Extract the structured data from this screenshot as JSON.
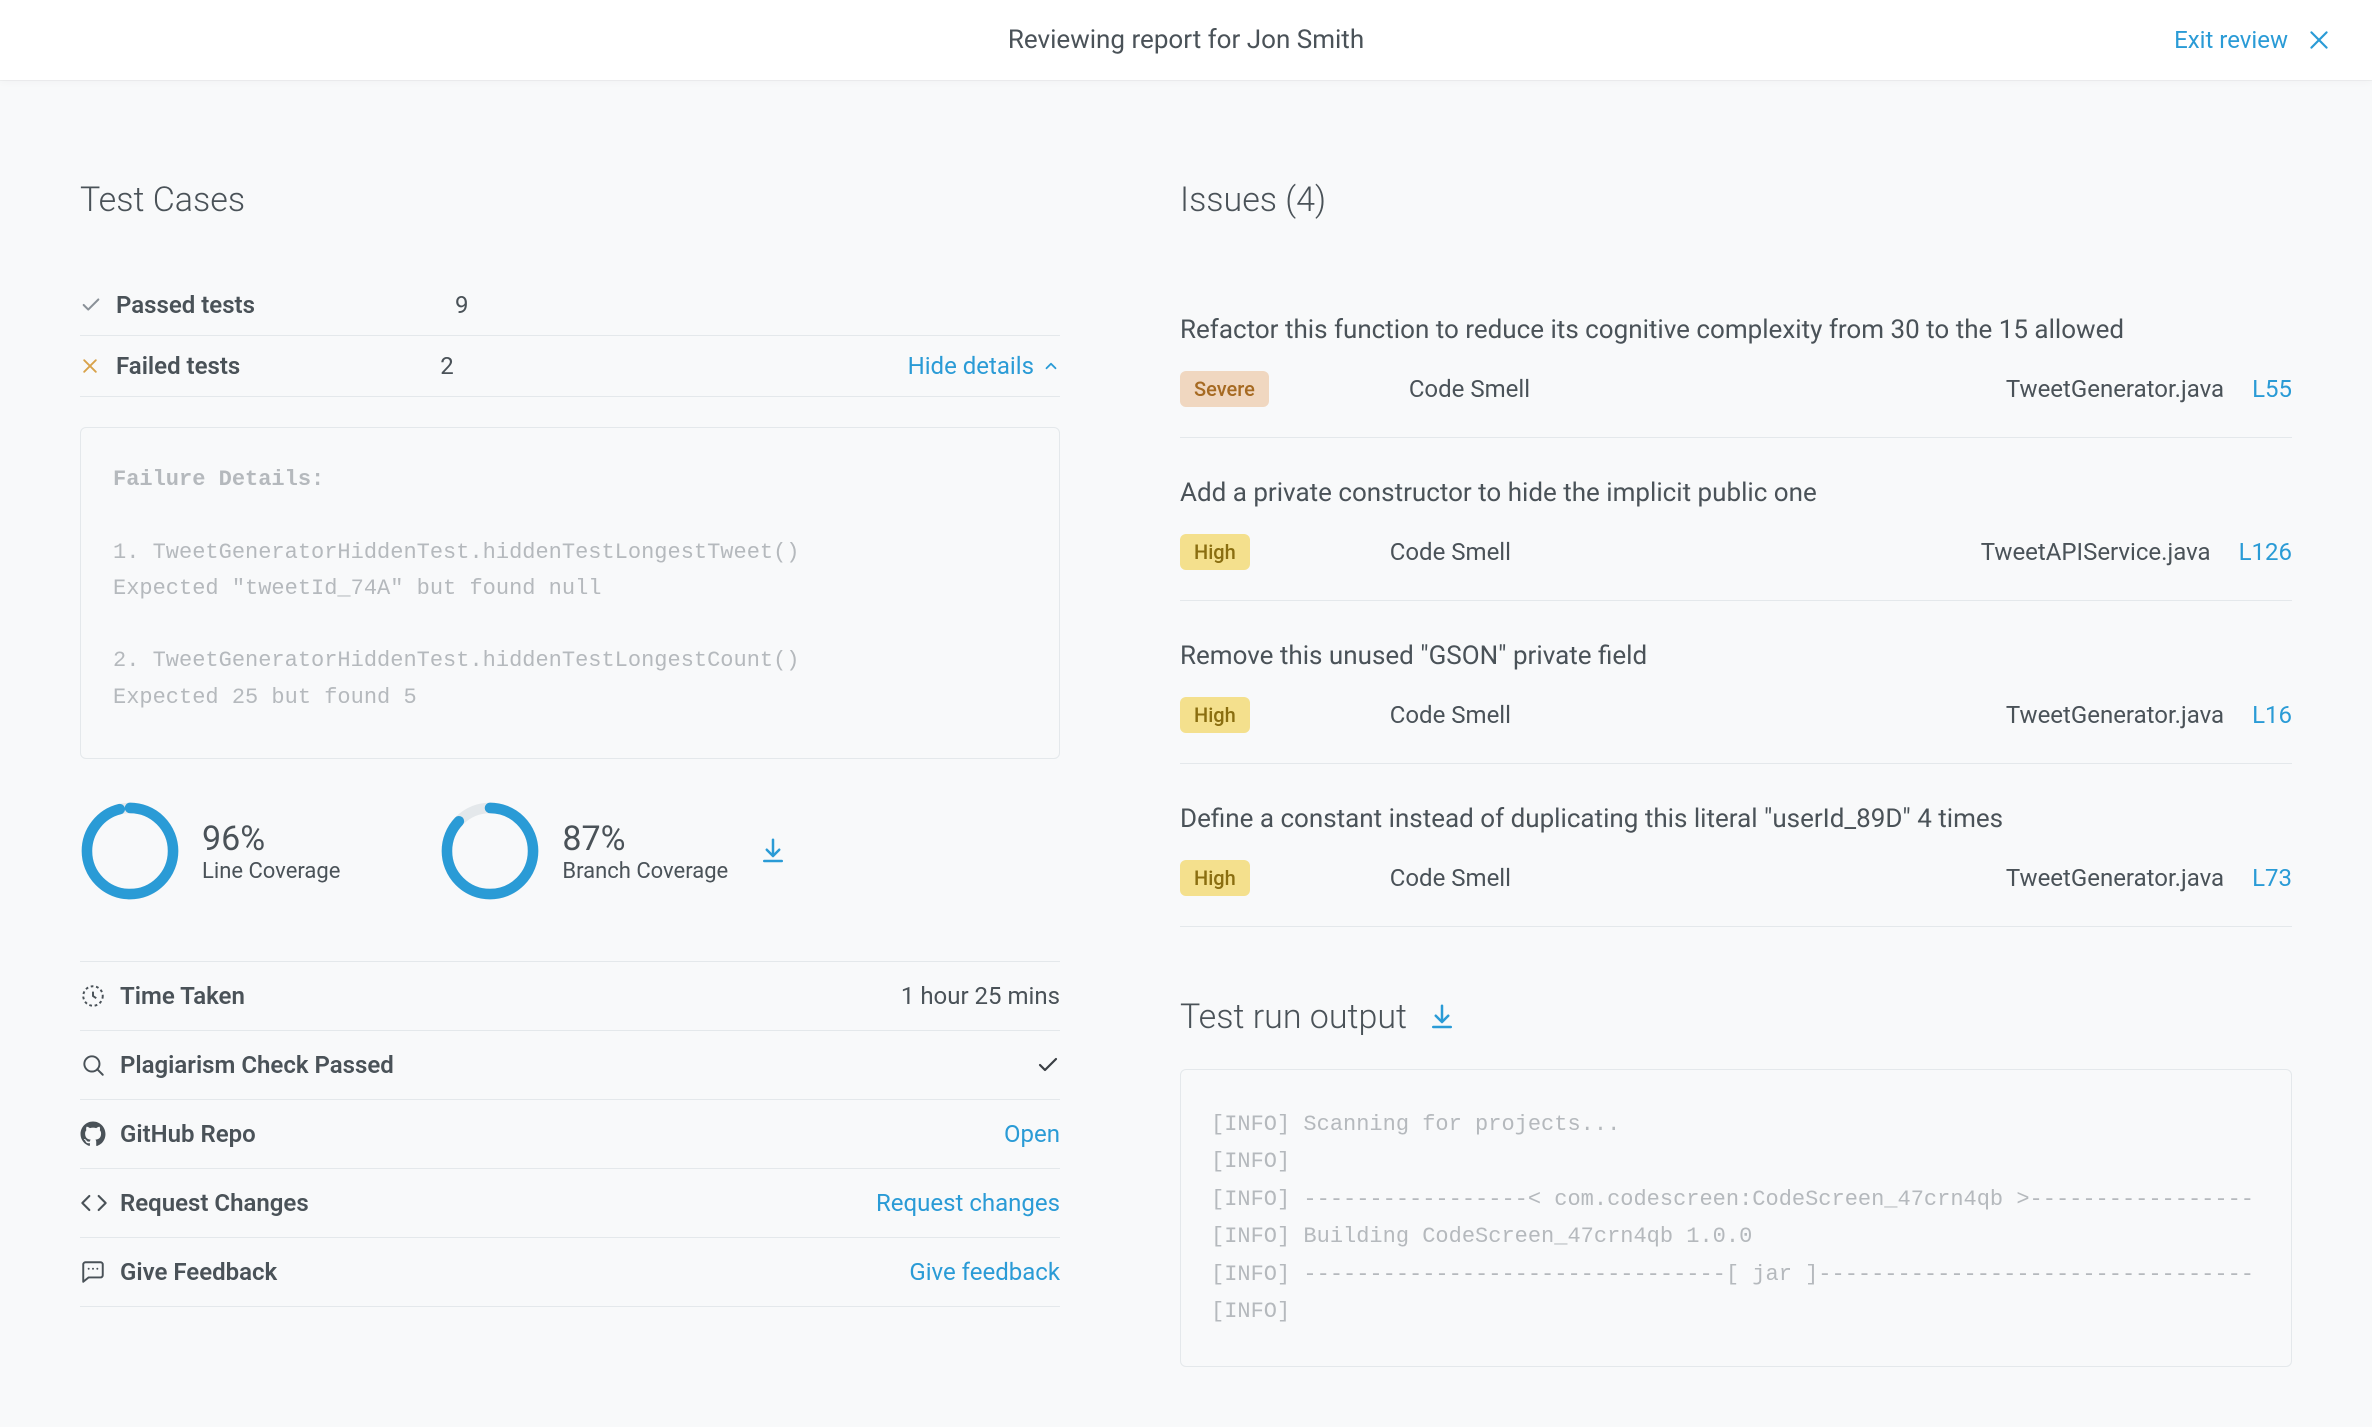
{
  "header": {
    "title": "Reviewing report for Jon Smith",
    "exit_label": "Exit review"
  },
  "left": {
    "section_title": "Test Cases",
    "passed": {
      "label": "Passed tests",
      "count": "9"
    },
    "failed": {
      "label": "Failed tests",
      "count": "2",
      "toggle_label": "Hide details"
    },
    "failure_header": "Failure Details:",
    "failure_body": "1. TweetGeneratorHiddenTest.hiddenTestLongestTweet()\nExpected \"tweetId_74A\" but found null\n\n2. TweetGeneratorHiddenTest.hiddenTestLongestCount()\nExpected 25 but found 5",
    "coverage": {
      "line": {
        "pct_text": "96%",
        "pct": 96,
        "label": "Line Coverage"
      },
      "branch": {
        "pct_text": "87%",
        "pct": 87,
        "label": "Branch Coverage"
      }
    },
    "rows": {
      "time": {
        "label": "Time Taken",
        "value": "1 hour 25 mins"
      },
      "plagiarism": {
        "label": "Plagiarism Check Passed"
      },
      "github": {
        "label": "GitHub Repo",
        "link": "Open"
      },
      "changes": {
        "label": "Request Changes",
        "link": "Request changes"
      },
      "feedback": {
        "label": "Give Feedback",
        "link": "Give feedback"
      }
    }
  },
  "right": {
    "section_title": "Issues (4)",
    "issues": [
      {
        "title": "Refactor this function to reduce its cognitive complexity from 30 to the 15 allowed",
        "severity": "Severe",
        "type": "Code Smell",
        "file": "TweetGenerator.java",
        "line": "L55"
      },
      {
        "title": "Add a private constructor to hide the implicit public one",
        "severity": "High",
        "type": "Code Smell",
        "file": "TweetAPIService.java",
        "line": "L126"
      },
      {
        "title": "Remove this unused \"GSON\" private field",
        "severity": "High",
        "type": "Code Smell",
        "file": "TweetGenerator.java",
        "line": "L16"
      },
      {
        "title": "Define a constant instead of duplicating this literal \"userId_89D\" 4 times",
        "severity": "High",
        "type": "Code Smell",
        "file": "TweetGenerator.java",
        "line": "L73"
      }
    ],
    "output_title": "Test run output",
    "output_body": "[INFO] Scanning for projects...\n[INFO]\n[INFO] -----------------< com.codescreen:CodeScreen_47crn4qb >-----------------\n[INFO] Building CodeScreen_47crn4qb 1.0.0\n[INFO] --------------------------------[ jar ]---------------------------------\n[INFO]"
  },
  "chart_data": [
    {
      "type": "pie",
      "title": "Line Coverage",
      "categories": [
        "covered",
        "uncovered"
      ],
      "values": [
        96,
        4
      ],
      "ylim": [
        0,
        100
      ]
    },
    {
      "type": "pie",
      "title": "Branch Coverage",
      "categories": [
        "covered",
        "uncovered"
      ],
      "values": [
        87,
        13
      ],
      "ylim": [
        0,
        100
      ]
    }
  ]
}
